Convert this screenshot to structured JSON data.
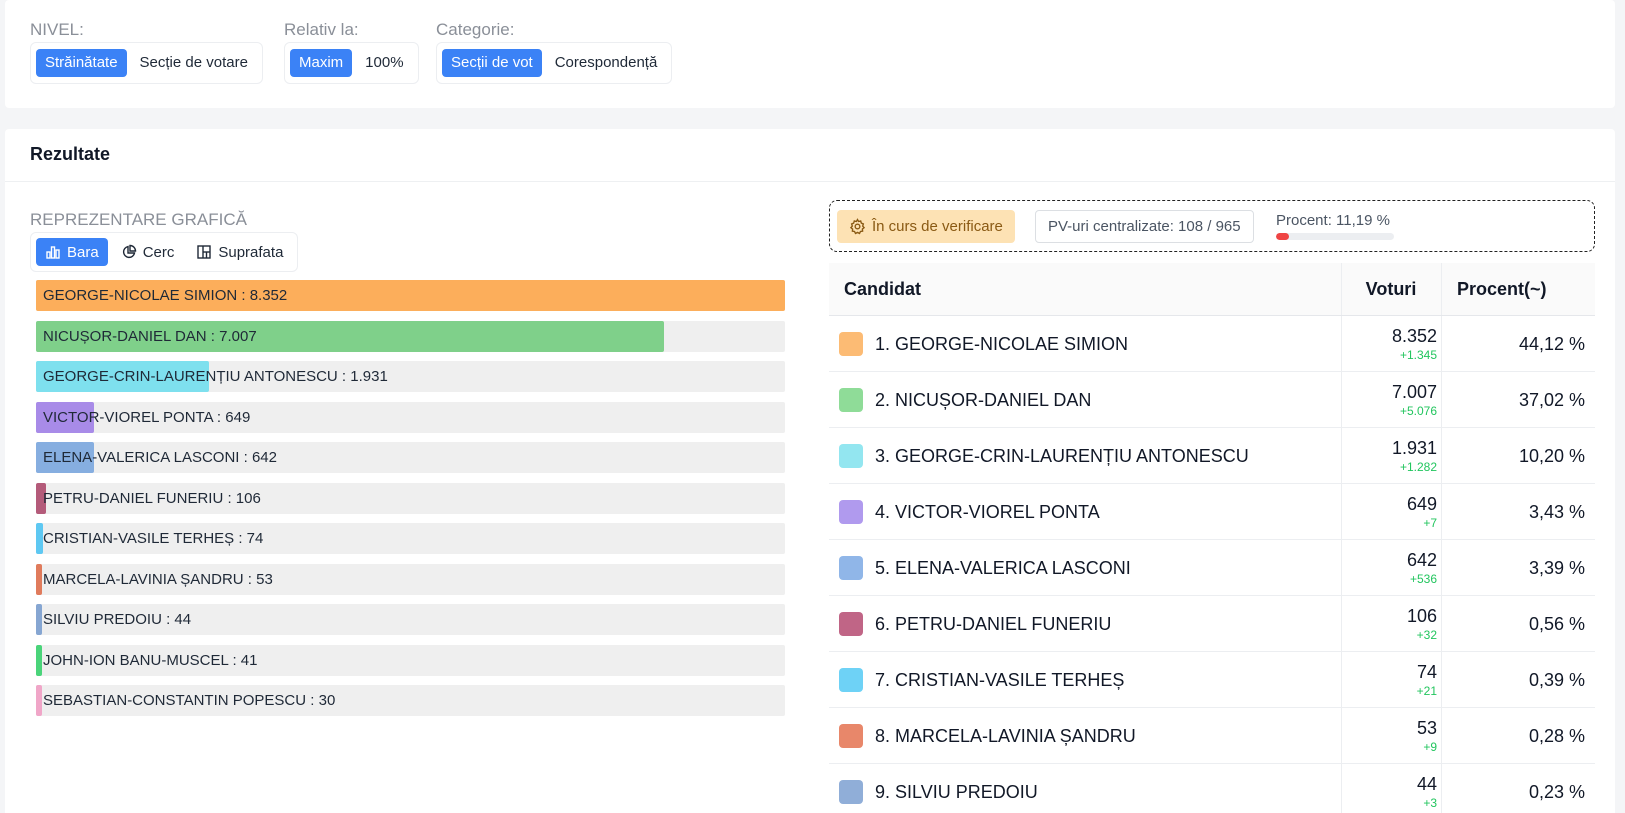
{
  "filters": {
    "nivel": {
      "label": "NIVEL:",
      "options": [
        "Străinătate",
        "Secție de votare"
      ],
      "selected": "Străinătate"
    },
    "relativ": {
      "label": "Relativ la:",
      "options": [
        "Maxim",
        "100%"
      ],
      "selected": "Maxim"
    },
    "categorie": {
      "label": "Categorie:",
      "options": [
        "Secții de vot",
        "Corespondență"
      ],
      "selected": "Secții de vot"
    }
  },
  "results": {
    "title": "Rezultate",
    "graph": {
      "label": "REPREZENTARE GRAFICĂ",
      "options": [
        {
          "label": "Bara",
          "icon": "bar-chart-icon"
        },
        {
          "label": "Cerc",
          "icon": "pie-chart-icon"
        },
        {
          "label": "Suprafata",
          "icon": "treemap-icon"
        }
      ],
      "selected": "Bara"
    },
    "status": {
      "verification": "În curs de verificare",
      "pv": "PV-uri centralizate: 108 / 965",
      "procent_label": "Procent: 11,19 %",
      "procent_value": 11.19
    },
    "table_headers": {
      "candidate": "Candidat",
      "votes": "Voturi",
      "percent": "Procent(~)"
    }
  },
  "chart_data": {
    "type": "bar",
    "title": "",
    "categories": [
      "GEORGE-NICOLAE SIMION",
      "NICUȘOR-DANIEL DAN",
      "GEORGE-CRIN-LAURENȚIU ANTONESCU",
      "VICTOR-VIOREL PONTA",
      "ELENA-VALERICA LASCONI",
      "PETRU-DANIEL FUNERIU",
      "CRISTIAN-VASILE TERHEȘ",
      "MARCELA-LAVINIA ȘANDRU",
      "SILVIU PREDOIU",
      "JOHN-ION BANU-MUSCEL",
      "SEBASTIAN-CONSTANTIN POPESCU"
    ],
    "values": [
      8352,
      7007,
      1931,
      649,
      642,
      106,
      74,
      53,
      44,
      41,
      30
    ],
    "labels": [
      "GEORGE-NICOLAE SIMION : 8.352",
      "NICUȘOR-DANIEL DAN : 7.007",
      "GEORGE-CRIN-LAURENȚIU ANTONESCU : 1.931",
      "VICTOR-VIOREL PONTA : 649",
      "ELENA-VALERICA LASCONI : 642",
      "PETRU-DANIEL FUNERIU : 106",
      "CRISTIAN-VASILE TERHEȘ : 74",
      "MARCELA-LAVINIA ȘANDRU : 53",
      "SILVIU PREDOIU : 44",
      "JOHN-ION BANU-MUSCEL : 41",
      "SEBASTIAN-CONSTANTIN POPESCU : 30"
    ],
    "colors": [
      "#fcae5b",
      "#7fd08a",
      "#7ee0ee",
      "#a88be8",
      "#86aee0",
      "#b45b7a",
      "#5ec8f2",
      "#e07b5c",
      "#86a6d2",
      "#4ad47a",
      "#f0a6c8"
    ],
    "xlim": [
      0,
      8352
    ],
    "orientation": "horizontal"
  },
  "candidates": [
    {
      "name": "1. GEORGE-NICOLAE SIMION",
      "votes": "8.352",
      "delta": "+1.345",
      "percent": "44,12 %",
      "color": "#fcbb74"
    },
    {
      "name": "2. NICUȘOR-DANIEL DAN",
      "votes": "7.007",
      "delta": "+5.076",
      "percent": "37,02 %",
      "color": "#8fdc98"
    },
    {
      "name": "3. GEORGE-CRIN-LAURENȚIU ANTONESCU",
      "votes": "1.931",
      "delta": "+1.282",
      "percent": "10,20 %",
      "color": "#93e6f0"
    },
    {
      "name": "4. VICTOR-VIOREL PONTA",
      "votes": "649",
      "delta": "+7",
      "percent": "3,43 %",
      "color": "#b09aee"
    },
    {
      "name": "5. ELENA-VALERICA LASCONI",
      "votes": "642",
      "delta": "+536",
      "percent": "3,39 %",
      "color": "#90b6e8"
    },
    {
      "name": "6. PETRU-DANIEL FUNERIU",
      "votes": "106",
      "delta": "+32",
      "percent": "0,56 %",
      "color": "#c06586"
    },
    {
      "name": "7. CRISTIAN-VASILE TERHEȘ",
      "votes": "74",
      "delta": "+21",
      "percent": "0,39 %",
      "color": "#6ed2f6"
    },
    {
      "name": "8. MARCELA-LAVINIA ȘANDRU",
      "votes": "53",
      "delta": "+9",
      "percent": "0,28 %",
      "color": "#e8876a"
    },
    {
      "name": "9. SILVIU PREDOIU",
      "votes": "44",
      "delta": "+3",
      "percent": "0,23 %",
      "color": "#90aed8"
    }
  ]
}
